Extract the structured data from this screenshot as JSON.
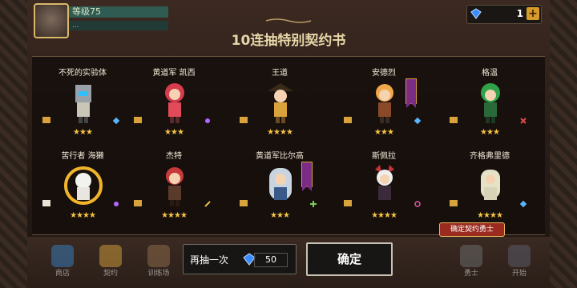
{
  "hud": {
    "level": "等级75",
    "sub": "..."
  },
  "currency": {
    "value": "1",
    "plus": "+"
  },
  "title": "10连抽特别契约书",
  "heroes": [
    {
      "name": "不死的实验体",
      "stars": "★★★"
    },
    {
      "name": "黄道军 凯西",
      "stars": "★★★"
    },
    {
      "name": "王道",
      "stars": "★★★★"
    },
    {
      "name": "安德烈",
      "stars": "★★★"
    },
    {
      "name": "格温",
      "stars": "★★★"
    },
    {
      "name": "苦行者 海獭",
      "stars": "★★★★"
    },
    {
      "name": "杰特",
      "stars": "★★★★"
    },
    {
      "name": "黄道军比尔高",
      "stars": "★★★"
    },
    {
      "name": "斯佩拉",
      "stars": "★★★★"
    },
    {
      "name": "齐格弗里德",
      "stars": "★★★★"
    }
  ],
  "confirm_tag": "确定契约勇士",
  "redo": {
    "label": "再抽一次",
    "cost": "50"
  },
  "ok": "确定",
  "nav": [
    "商店",
    "契约",
    "训练场",
    "",
    "",
    "",
    "",
    "",
    "勇士",
    "开始"
  ],
  "colors": {
    "gem": "#3a8bff",
    "star": "#f6c342",
    "banner": "#7b2d86"
  }
}
